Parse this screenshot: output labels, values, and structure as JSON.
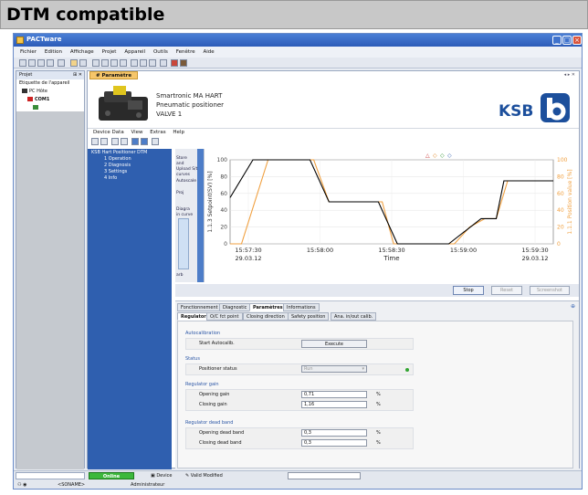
{
  "banner": {
    "title": "DTM compatible"
  },
  "window": {
    "title": "PACTware"
  },
  "menubar": [
    "Fichier",
    "Edition",
    "Affichage",
    "Projet",
    "Appareil",
    "Outils",
    "Fenêtre",
    "Aide"
  ],
  "left_panel": {
    "header": "Projet",
    "header_icons": "⊞ ✕",
    "items": [
      "Etiquette de l'appareil",
      "PC Hôte",
      "COM1"
    ]
  },
  "main_tab": {
    "label": "# Paramètre"
  },
  "device": {
    "name": "Smartronic MA HART",
    "type": "Pneumatic positioner",
    "tag": "VALVE 1",
    "brand": "KSB"
  },
  "device_menu": [
    "Device Data",
    "View",
    "Extras",
    "Help"
  ],
  "tree": {
    "root": "KSB Hart Positioner DTM",
    "items": [
      "1 Operation",
      "2 Diagnosis",
      "3 Settings",
      "4 Info"
    ]
  },
  "trend_side": {
    "labels": [
      "Store",
      "and",
      "Upload S/t",
      "curves",
      "Autoscale",
      "Proj",
      "Diagra",
      "in curve",
      "arb"
    ]
  },
  "chart_data": {
    "type": "line",
    "x_ticks": [
      "15:57:30",
      "15:58:00",
      "15:58:30",
      "15:59:00",
      "15:59:30"
    ],
    "x_dates": [
      "29.03.12",
      "29.03.12"
    ],
    "xlabel": "Time",
    "ylabel": "1.1.3 Setpoint(SV) [%]",
    "y2label": "1.1.1 Position value [%]",
    "y_ticks": [
      0,
      20,
      40,
      60,
      80,
      100
    ],
    "ylim": [
      0,
      100
    ],
    "colors": {
      "setpoint": "#000000",
      "position": "#f0a040"
    },
    "series": [
      {
        "key": "setpoint",
        "x": [
          0,
          12,
          42,
          52,
          78,
          88,
          115,
          132,
          140,
          144,
          158,
          170
        ],
        "y": [
          55,
          100,
          100,
          50,
          50,
          0,
          0,
          30,
          30,
          75,
          75,
          75
        ]
      },
      {
        "key": "position",
        "x": [
          0,
          6,
          20,
          44,
          52,
          80,
          86,
          118,
          126,
          134,
          140,
          146,
          160,
          170
        ],
        "y": [
          0,
          0,
          100,
          100,
          50,
          50,
          0,
          0,
          20,
          30,
          30,
          75,
          75,
          75
        ]
      }
    ]
  },
  "trend_buttons": [
    "Stop",
    "Reset",
    "Screenshot"
  ],
  "tabs1": [
    "Fonctionnement",
    "Diagnostic",
    "Paramètres",
    "Informations"
  ],
  "tabs2": [
    "Regulator",
    "O/C fct point",
    "Closing direction",
    "Safety position",
    "Ana. in/out calib."
  ],
  "groups": {
    "autocal": {
      "title": "Autocalibration",
      "label": "Start Autocalib.",
      "button": "Execute"
    },
    "status": {
      "title": "Status",
      "label": "Positioner status",
      "value": "Run"
    },
    "gain": {
      "title": "Regulator gain",
      "rows": [
        {
          "label": "Opening gain",
          "value": "0,71",
          "unit": "%"
        },
        {
          "label": "Closing gain",
          "value": "1,16",
          "unit": "%"
        }
      ]
    },
    "deadband": {
      "title": "Regulator dead band",
      "rows": [
        {
          "label": "Opening dead band",
          "value": "0,3",
          "unit": "%"
        },
        {
          "label": "Closing dead band",
          "value": "0,3",
          "unit": "%"
        }
      ]
    }
  },
  "statusbar": {
    "online": "Online",
    "device": "Device",
    "valid": "Valid Modified",
    "noname": "<SONAME>",
    "user": "Administrateur"
  }
}
